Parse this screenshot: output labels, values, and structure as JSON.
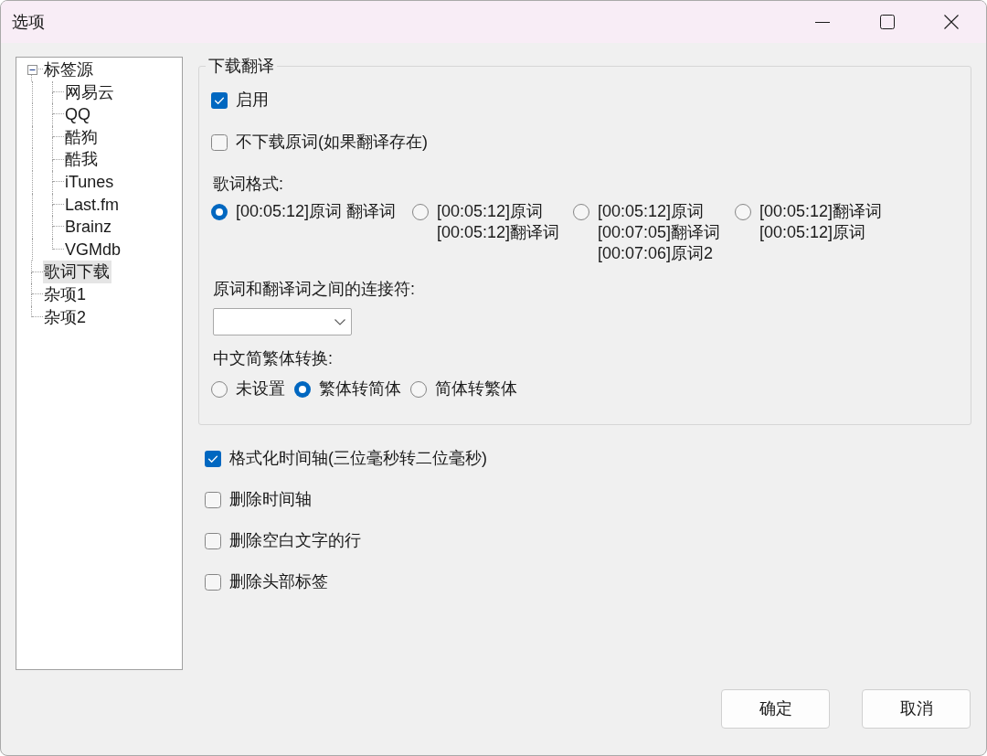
{
  "window": {
    "title": "选项"
  },
  "tree": {
    "items": [
      {
        "label": "标签源",
        "expanded": true,
        "selected": false,
        "children": [
          {
            "label": "网易云",
            "selected": false
          },
          {
            "label": "QQ",
            "selected": false
          },
          {
            "label": "酷狗",
            "selected": false
          },
          {
            "label": "酷我",
            "selected": false
          },
          {
            "label": "iTunes",
            "selected": false
          },
          {
            "label": "Last.fm",
            "selected": false
          },
          {
            "label": "Brainz",
            "selected": false
          },
          {
            "label": "VGMdb",
            "selected": false
          }
        ]
      },
      {
        "label": "歌词下载",
        "selected": true
      },
      {
        "label": "杂项1",
        "selected": false
      },
      {
        "label": "杂项2",
        "selected": false
      }
    ]
  },
  "download_translation": {
    "title": "下载翻译",
    "checkboxes": [
      {
        "label": "启用",
        "checked": true
      },
      {
        "label": "不下载原词(如果翻译存在)",
        "checked": false
      }
    ],
    "lyric_format": {
      "label": "歌词格式:",
      "options": [
        {
          "lines": [
            "[00:05:12]原词 翻译词"
          ],
          "selected": true
        },
        {
          "lines": [
            "[00:05:12]原词",
            "[00:05:12]翻译词"
          ],
          "selected": false
        },
        {
          "lines": [
            "[00:05:12]原词",
            "[00:07:05]翻译词",
            "[00:07:06]原词2"
          ],
          "selected": false
        },
        {
          "lines": [
            "[00:05:12]翻译词",
            "[00:05:12]原词"
          ],
          "selected": false
        }
      ]
    },
    "separator": {
      "label": "原词和翻译词之间的连接符:"
    },
    "conversion": {
      "label": "中文简繁体转换:",
      "options": [
        {
          "label": "未设置",
          "selected": false
        },
        {
          "label": "繁体转简体",
          "selected": true
        },
        {
          "label": "简体转繁体",
          "selected": false
        }
      ]
    }
  },
  "options": [
    {
      "label": "格式化时间轴(三位毫秒转二位毫秒)",
      "checked": true
    },
    {
      "label": "删除时间轴",
      "checked": false
    },
    {
      "label": "删除空白文字的行",
      "checked": false
    },
    {
      "label": "删除头部标签",
      "checked": false
    }
  ],
  "buttons": [
    "确定",
    "取消"
  ]
}
